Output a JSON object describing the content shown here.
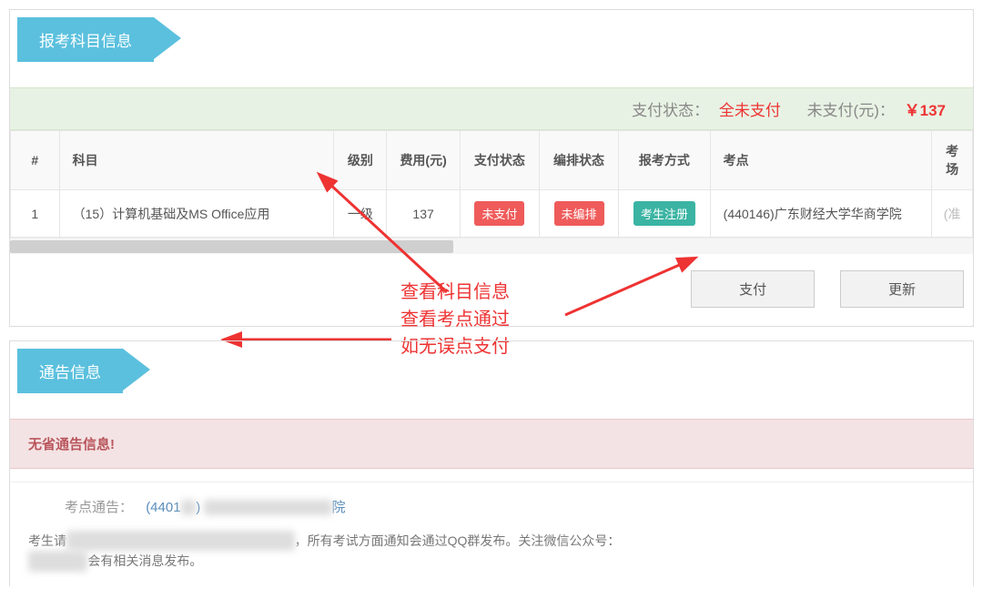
{
  "section1": {
    "title": "报考科目信息",
    "status_label1": "支付状态：",
    "status_value1": "全未支付",
    "status_label2": "未支付(元)：",
    "status_value2": "￥137",
    "columns": {
      "idx": "#",
      "subject": "科目",
      "level": "级别",
      "fee": "费用(元)",
      "pay_status": "支付状态",
      "arrange_status": "编排状态",
      "method": "报考方式",
      "site": "考点",
      "extra": "考场"
    },
    "row": {
      "idx": "1",
      "subject": "（15）计算机基础及MS Office应用",
      "level": "一级",
      "fee": "137",
      "pay_status": "未支付",
      "arrange_status": "未编排",
      "method": "考生注册",
      "site": "(440146)广东财经大学华商学院",
      "extra": "(准"
    },
    "buttons": {
      "pay": "支付",
      "refresh": "更新"
    }
  },
  "annotation": {
    "line1": "查看科目信息",
    "line2": "查看考点通过",
    "line3": "如无误点支付"
  },
  "section2": {
    "title": "通告信息",
    "alert": "无省通告信息!",
    "sub_label": "考点通告：",
    "sub_value": "(4401■■) ■■■■■■■■■■院",
    "body_prefix": "考生请■■■■■■■■■■■■■■■■■■■■■■■，所有考试方面通知会通过QQ群发布。关注微信公众号：",
    "body_suffix": "■■■■■会有相关消息发布。"
  }
}
